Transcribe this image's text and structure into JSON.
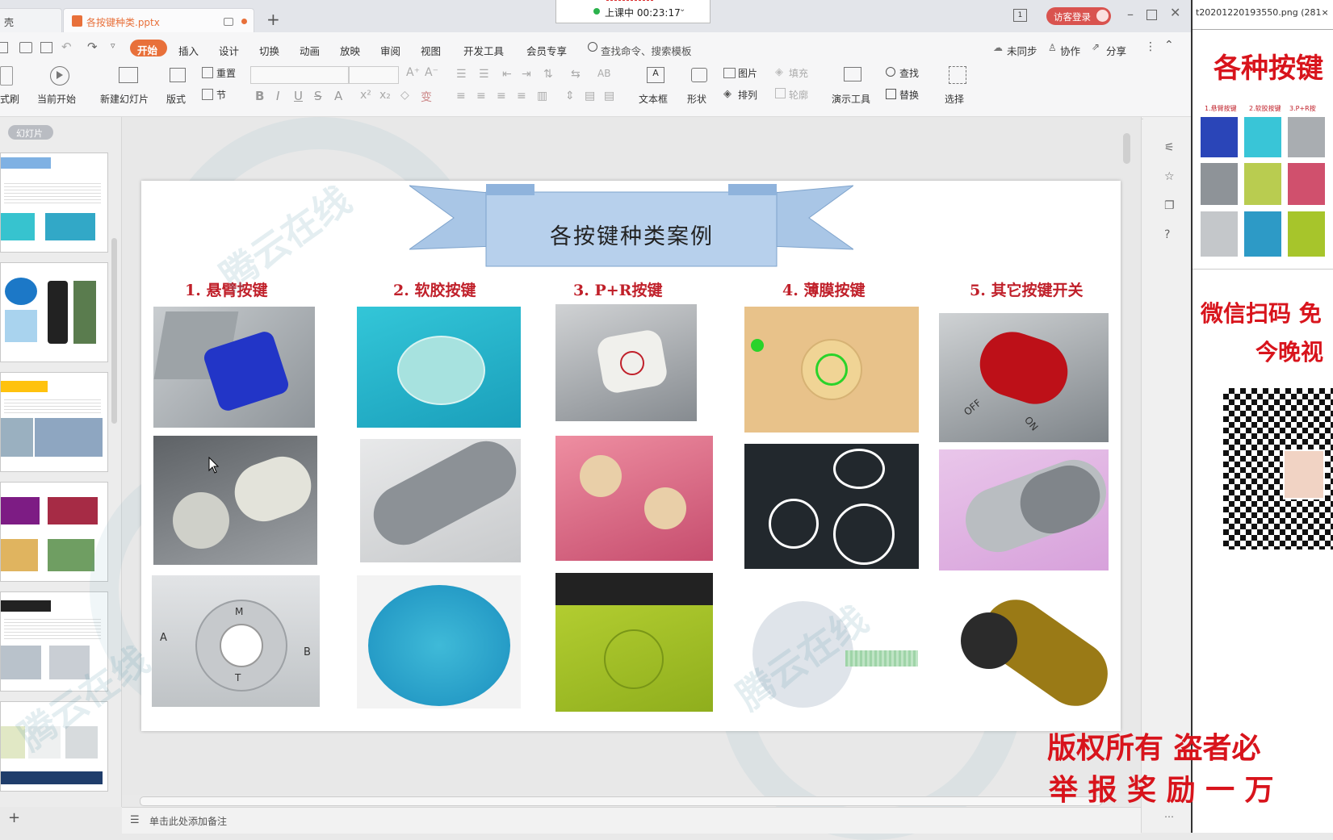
{
  "titlebar": {
    "partial_left": "壳",
    "doc_tab": "各按键种类.pptx",
    "class_timer": "上课中 00:23:17",
    "login_btn": "访客登录",
    "page_badge": "1"
  },
  "menu": {
    "items": [
      "开始",
      "插入",
      "设计",
      "切换",
      "动画",
      "放映",
      "审阅",
      "视图",
      "开发工具",
      "会员专享"
    ],
    "search": "查找命令、搜索模板",
    "sync": "未同步",
    "collab": "协作",
    "share": "分享"
  },
  "ribbon": {
    "format_painter": "式刷",
    "from_start": "当前开始",
    "new_slide": "新建幻灯片",
    "layout": "版式",
    "reset": "重置",
    "section": "节",
    "textbox": "文本框",
    "shape": "形状",
    "picture": "图片",
    "fill": "填充",
    "arrange": "排列",
    "outline": "轮廓",
    "present_tool": "演示工具",
    "find": "查找",
    "replace": "替换",
    "select": "选择"
  },
  "leftpanel": {
    "label": "幻灯片"
  },
  "slide": {
    "banner_title": "各按键种类案例",
    "captions": [
      "1. 悬臂按键",
      "2. 软胶按键",
      "3. P+R按键",
      "4. 薄膜按键",
      "5. 其它按键开关"
    ],
    "img_text": {
      "off": "OFF",
      "on": "ON",
      "m": "M",
      "a": "A",
      "b": "B",
      "t": "T"
    }
  },
  "notes": {
    "placeholder": "单击此处添加备注"
  },
  "external": {
    "filename": "t20201220193550.png (281×",
    "title": "各种按键",
    "wechat1": "微信扫码 免",
    "wechat2": "今晚视",
    "copyright1": "版权所有 盗者必",
    "copyright2": "举 报 奖 励 一 万",
    "thumb_labels": [
      "1.悬臂按键",
      "2.软胶按键",
      "3.P+R按"
    ]
  },
  "watermark": {
    "text": "腾云在线"
  },
  "colors": {
    "accent_red": "#d8141c",
    "caption_red": "#c0202a",
    "menu_active": "#e8703a",
    "banner_blue": "#a9c6e6"
  }
}
